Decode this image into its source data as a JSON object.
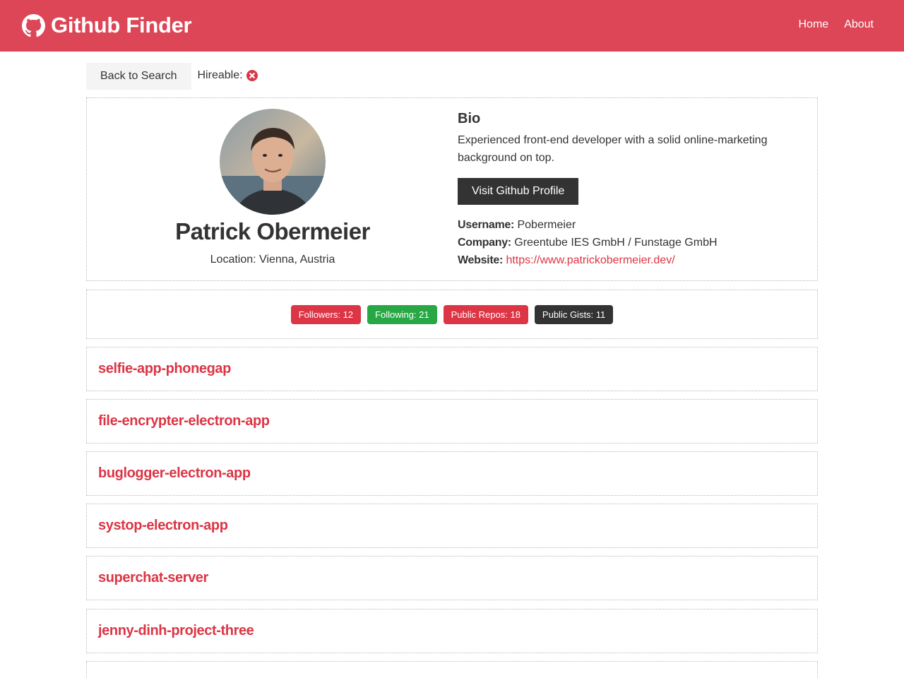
{
  "brand": {
    "title": "Github Finder",
    "color": "#dc4656"
  },
  "nav": {
    "home": "Home",
    "about": "About"
  },
  "toolbar": {
    "back_label": "Back to Search",
    "hireable_label": "Hireable:",
    "hireable_icon": "times-circle-icon"
  },
  "profile": {
    "name": "Patrick Obermeier",
    "location": "Location: Vienna, Austria",
    "bio_heading": "Bio",
    "bio": "Experienced front-end developer with a solid online-marketing background on top.",
    "visit_label": "Visit Github Profile",
    "username_label": "Username:",
    "username": "Pobermeier",
    "company_label": "Company:",
    "company": "Greentube IES GmbH / Funstage GmbH",
    "website_label": "Website:",
    "website": "https://www.patrickobermeier.dev/"
  },
  "stats": {
    "followers": "Followers: 12",
    "following": "Following: 21",
    "repos": "Public Repos: 18",
    "gists": "Public Gists: 11",
    "colors": {
      "primary": "#dc3545",
      "success": "#28a745",
      "dark": "#333333"
    }
  },
  "repos": [
    "selfie-app-phonegap",
    "file-encrypter-electron-app",
    "buglogger-electron-app",
    "systop-electron-app",
    "superchat-server",
    "jenny-dinh-project-three"
  ]
}
